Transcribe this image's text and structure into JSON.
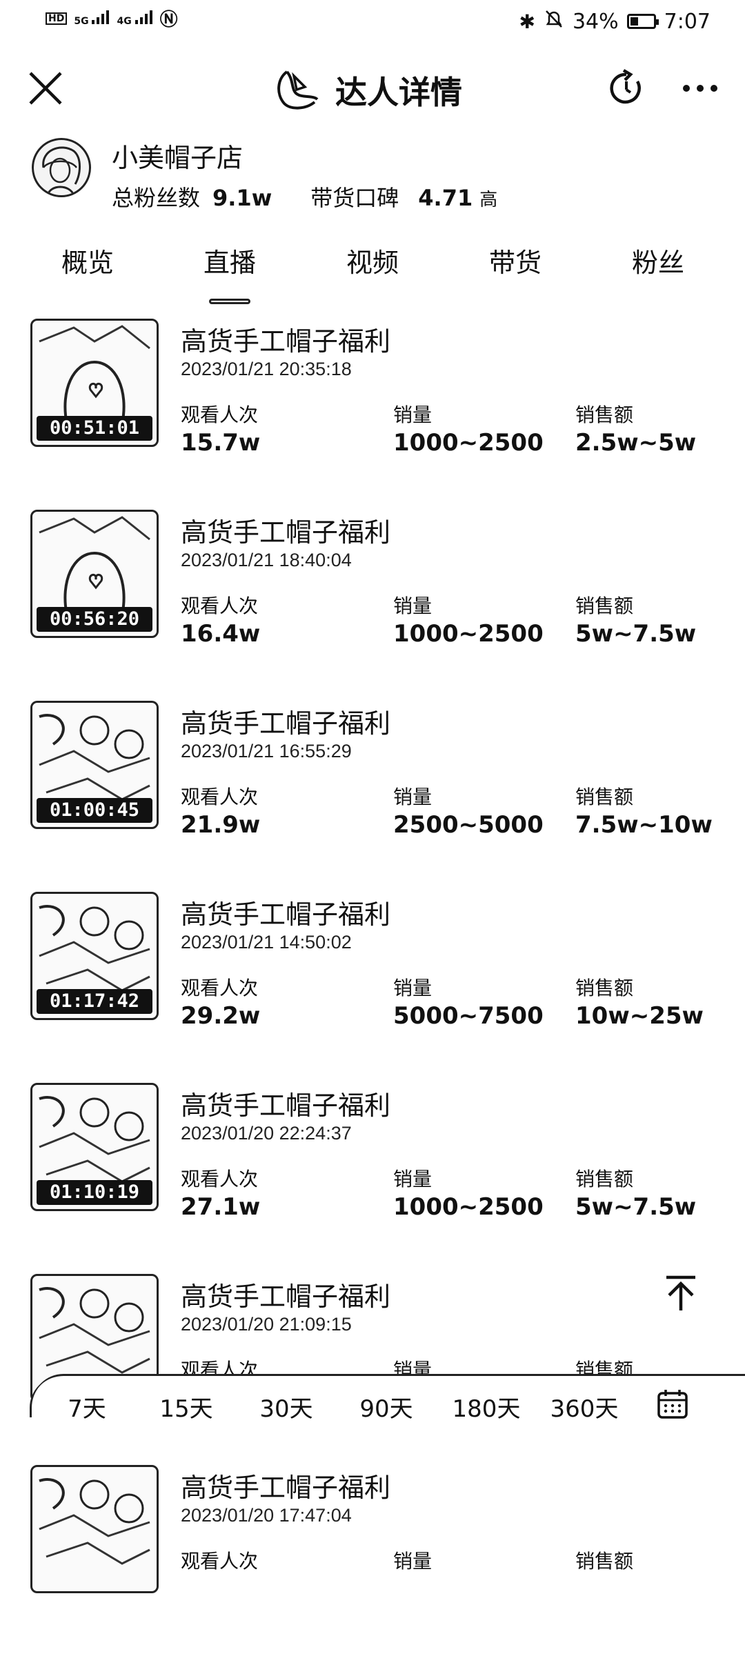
{
  "status_bar": {
    "left_labels": [
      "HD",
      "5G",
      "4G"
    ],
    "battery": "34%",
    "battery_level": 0.34,
    "time": "7:07"
  },
  "header": {
    "title": "达人详情"
  },
  "profile": {
    "name": "小美帽子店",
    "fans_label": "总粉丝数",
    "fans_value": "9.1w",
    "rating_label": "带货口碑",
    "rating_value": "4.71",
    "rating_grade": "高"
  },
  "tabs": [
    {
      "label": "概览"
    },
    {
      "label": "直播"
    },
    {
      "label": "视频"
    },
    {
      "label": "带货"
    },
    {
      "label": "粉丝"
    }
  ],
  "active_tab": "直播",
  "metric_labels": {
    "views": "观看人次",
    "sales": "销量",
    "revenue": "销售额"
  },
  "streams": [
    {
      "title": "高货手工帽子福利",
      "time": "2023/01/21 20:35:18",
      "duration": "00:51:01",
      "views": "15.7w",
      "sales": "1000~2500",
      "revenue": "2.5w~5w"
    },
    {
      "title": "高货手工帽子福利",
      "time": "2023/01/21 18:40:04",
      "duration": "00:56:20",
      "views": "16.4w",
      "sales": "1000~2500",
      "revenue": "5w~7.5w"
    },
    {
      "title": "高货手工帽子福利",
      "time": "2023/01/21 16:55:29",
      "duration": "01:00:45",
      "views": "21.9w",
      "sales": "2500~5000",
      "revenue": "7.5w~10w"
    },
    {
      "title": "高货手工帽子福利",
      "time": "2023/01/21 14:50:02",
      "duration": "01:17:42",
      "views": "29.2w",
      "sales": "5000~7500",
      "revenue": "10w~25w"
    },
    {
      "title": "高货手工帽子福利",
      "time": "2023/01/20 22:24:37",
      "duration": "01:10:19",
      "views": "27.1w",
      "sales": "1000~2500",
      "revenue": "5w~7.5w"
    },
    {
      "title": "高货手工帽子福利",
      "time": "2023/01/20 21:09:15",
      "duration": "",
      "views": "",
      "sales": "",
      "revenue": ""
    },
    {
      "title": "高货手工帽子福利",
      "time": "2023/01/20 17:47:04",
      "duration": "",
      "views": "",
      "sales": "",
      "revenue": ""
    }
  ],
  "filter": {
    "options": [
      "7天",
      "15天",
      "30天",
      "90天",
      "180天",
      "360天"
    ]
  },
  "icons": {
    "close": "close-icon",
    "logo": "logo-icon",
    "refresh": "refresh-icon",
    "more": "more-icon",
    "to_top": "back-to-top-icon",
    "calendar": "calendar-icon"
  }
}
